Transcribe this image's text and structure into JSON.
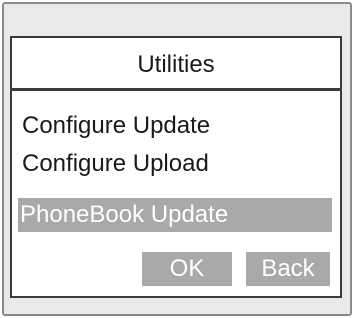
{
  "dialog": {
    "title": "Utilities"
  },
  "menu": {
    "items": [
      {
        "label": "Configure Update",
        "selected": false
      },
      {
        "label": "Configure Upload",
        "selected": false
      },
      {
        "label": "PhoneBook Update",
        "selected": true
      }
    ]
  },
  "softkeys": {
    "ok_label": "OK",
    "back_label": "Back"
  },
  "colors": {
    "highlight": "#a9a9a9",
    "highlight_text": "#ffffff",
    "text": "#1a1a1a",
    "border": "#3a3a3a",
    "frame_background": "#e9e9e9"
  }
}
